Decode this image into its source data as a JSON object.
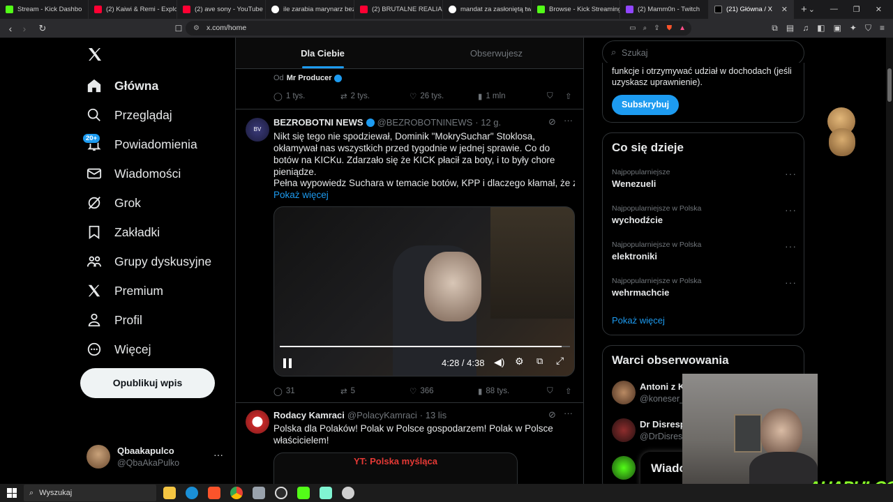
{
  "browser": {
    "tabs": [
      {
        "title": "Stream - Kick Dashbo",
        "color": "#53fc18"
      },
      {
        "title": "(2) Kaiwi & Remi - Explosi",
        "color": "#ff0033"
      },
      {
        "title": "(2) ave sony - YouTube",
        "color": "#ff0033"
      },
      {
        "title": "ile zarabia marynarz bez do",
        "color": "#ffffff"
      },
      {
        "title": "(2) BRUTALNE REALIA MA",
        "color": "#ff0033"
      },
      {
        "title": "mandat za zasłoniętą twarz",
        "color": "#ffffff"
      },
      {
        "title": "Browse - Kick Streaming",
        "color": "#53fc18"
      },
      {
        "title": "(2) Mamm0n - Twitch",
        "color": "#9146ff"
      },
      {
        "title": "(21) Główna / X",
        "color": "#ffffff",
        "active": true
      }
    ],
    "url": "x.com/home"
  },
  "nav": {
    "items": [
      {
        "label": "Główna",
        "icon": "home-icon"
      },
      {
        "label": "Przeglądaj",
        "icon": "search-icon"
      },
      {
        "label": "Powiadomienia",
        "icon": "bell-icon",
        "badge": "20+"
      },
      {
        "label": "Wiadomości",
        "icon": "envelope-icon"
      },
      {
        "label": "Grok",
        "icon": "grok-icon"
      },
      {
        "label": "Zakładki",
        "icon": "bookmark-icon"
      },
      {
        "label": "Grupy dyskusyjne",
        "icon": "people-icon"
      },
      {
        "label": "Premium",
        "icon": "x-logo-icon"
      },
      {
        "label": "Profil",
        "icon": "person-icon"
      },
      {
        "label": "Więcej",
        "icon": "more-circle-icon"
      }
    ],
    "post_button": "Opublikuj wpis",
    "account": {
      "name": "Qbaakapulco",
      "handle": "@QbaAkaPulko"
    }
  },
  "feed": {
    "tabs": [
      "Dla Ciebie",
      "Obserwujesz"
    ],
    "top_partial": {
      "from_prefix": "Od",
      "from": "Mr Producer",
      "replies": "1 tys.",
      "reposts": "2 tys.",
      "likes": "26 tys.",
      "views": "1 mln"
    },
    "tweet1": {
      "name": "BEZROBOTNI NEWS",
      "handle": "@BEZROBOTNINEWS",
      "time": "· 12 g.",
      "text": "Nikt się tego nie spodziewał, Dominik \"MokrySuchar\" Stoklosa, okłamywał nas wszystkich przed tygodnie w jednej sprawie. Co do botów na KICKu. Zdarzało się że KICK płacił za boty, i to były chore pieniądze.",
      "text2": "Pełna wypowiedz Suchara w temacie botów, KPP i dlaczego kłamał, że za",
      "show_more": "Pokaż więcej",
      "video_time": "4:28 / 4:38",
      "video_progress": 0.97,
      "replies": "31",
      "reposts": "5",
      "likes": "366",
      "views": "88 tys."
    },
    "tweet2": {
      "name": "Rodacy Kamraci",
      "handle": "@PolacyKamraci",
      "time": "· 13 lis",
      "text": "Polska dla Polaków! Polak w Polsce gospodarzem! Polak w Polsce właścicielem!",
      "media_caption": "YT: Polska myśląca"
    }
  },
  "right": {
    "search_placeholder": "Szukaj",
    "premium": {
      "text": "funkcje i otrzymywać udział w dochodach (jeśli uzyskasz uprawnienie).",
      "button": "Subskrybuj"
    },
    "trends": {
      "title": "Co się dzieje",
      "items": [
        {
          "category": "Najpopularniejsze",
          "name": "Wenezueli"
        },
        {
          "category": "Najpopularniejsze w Polska",
          "name": "wychodźcie"
        },
        {
          "category": "Najpopularniejsze w Polska",
          "name": "elektroniki"
        },
        {
          "category": "Najpopularniejsze w Polska",
          "name": "wehrmachcie"
        }
      ],
      "show_more": "Pokaż więcej"
    },
    "follow": {
      "title": "Warci obserwowania",
      "items": [
        {
          "name": "Antoni z K",
          "handle": "@koneser_"
        },
        {
          "name": "Dr Disresp",
          "handle": "@DrDisres"
        }
      ]
    },
    "messages_label": "Wiado"
  },
  "overlay": {
    "logo_text": "AHAPULCO"
  },
  "taskbar": {
    "search": "Wyszukaj"
  }
}
